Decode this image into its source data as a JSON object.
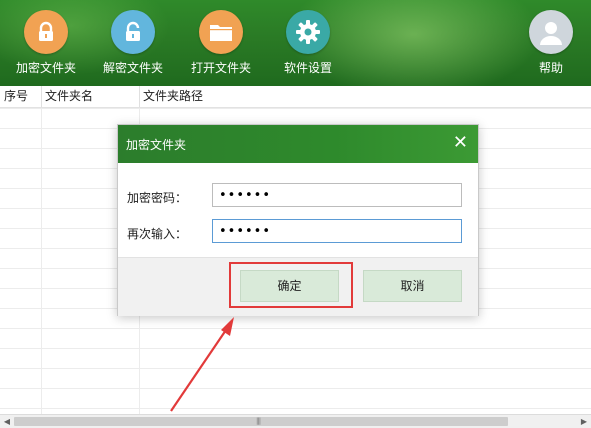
{
  "toolbar": {
    "encrypt_folder": "加密文件夹",
    "decrypt_folder": "解密文件夹",
    "open_folder": "打开文件夹",
    "settings": "软件设置",
    "help": "帮助"
  },
  "table": {
    "columns": [
      "序号",
      "文件夹名",
      "文件夹路径"
    ],
    "rows": []
  },
  "dialog": {
    "title": "加密文件夹",
    "close_glyph": "✕",
    "password_label": "加密密码：",
    "password_value": "••••••",
    "confirm_label": "再次输入：",
    "confirm_value": "••••••",
    "ok_button": "确定",
    "cancel_button": "取消"
  },
  "icons": {
    "encrypt": "lock-icon",
    "decrypt": "unlock-icon",
    "open": "folder-icon",
    "settings": "gear-icon",
    "help": "user-icon"
  },
  "colors": {
    "toolbar_green": "#2a7a25",
    "annotation_red": "#e23a3a",
    "button_green": "#d9ead9"
  }
}
